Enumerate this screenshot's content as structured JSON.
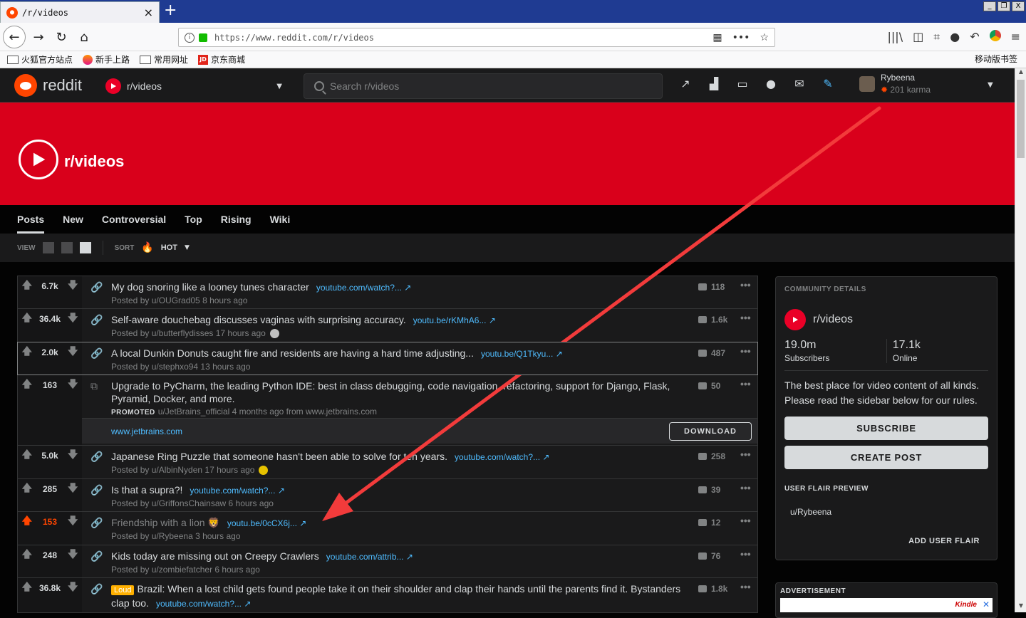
{
  "browser": {
    "tab_title": "/r/videos",
    "tab_close": "×",
    "new_tab": "+",
    "url": "https://www.reddit.com/r/videos",
    "nav": {
      "back": "←",
      "forward": "→",
      "reload": "↻",
      "home": "⌂"
    },
    "url_right": {
      "qr": "▦",
      "more": "•••",
      "star": "☆"
    },
    "tools": {
      "library": "|||\\",
      "sidebar": "◫",
      "crop": "⌗",
      "chat": "●",
      "undo": "↶",
      "menu": "≡"
    },
    "window_buttons": [
      "_",
      "❐",
      "X"
    ],
    "bookmarks": [
      {
        "label": "火狐官方站点",
        "icon": "folder-icon"
      },
      {
        "label": "新手上路",
        "icon": "firefox-icon"
      },
      {
        "label": "常用网址",
        "icon": "folder-icon"
      },
      {
        "label": "京东商城",
        "icon": "jd-icon",
        "icon_text": "JD"
      }
    ],
    "mobile_bookmarks": "移动版书签"
  },
  "header": {
    "logo_text": "reddit",
    "subreddit": "r/videos",
    "search_placeholder": "Search r/videos",
    "icons": [
      "trending-icon",
      "stats-icon",
      "cc-icon",
      "chat-icon",
      "mail-icon",
      "pencil-icon"
    ],
    "icon_glyphs": [
      "↗",
      "▟",
      "▭",
      "●",
      "✉",
      "✎"
    ],
    "username": "Rybeena",
    "karma": "201 karma",
    "caret": "▼"
  },
  "banner": {
    "title": "r/videos"
  },
  "tabs": [
    {
      "label": "Posts",
      "active": true
    },
    {
      "label": "New"
    },
    {
      "label": "Controversial"
    },
    {
      "label": "Top"
    },
    {
      "label": "Rising"
    },
    {
      "label": "Wiki"
    }
  ],
  "viewbar": {
    "view_label": "VIEW",
    "sort_label": "SORT",
    "sort_value": "HOT",
    "flame": "🔥",
    "caret": "▼"
  },
  "posts": [
    {
      "score": "6.7k",
      "title": "My dog snoring like a looney tunes character",
      "domain": "youtube.com/watch?...",
      "meta": "Posted by u/OUGrad05 8 hours ago",
      "comments": "118"
    },
    {
      "score": "36.4k",
      "title": "Self-aware douchebag discusses vaginas with surprising accuracy.",
      "domain": "youtu.be/rKMhA6...",
      "meta": "Posted by u/butterflydisses 17 hours ago",
      "comments": "1.6k",
      "badge": "silver-award-icon"
    },
    {
      "score": "2.0k",
      "title": "A local Dunkin Donuts caught fire and residents are having a hard time adjusting...",
      "domain": "youtu.be/Q1Tkyu...",
      "meta": "Posted by u/stephxo94 13 hours ago",
      "comments": "487",
      "highlight": true
    },
    {
      "score": "163",
      "title": "Upgrade to PyCharm, the leading Python IDE: best in class debugging, code navigation, refactoring, support for Django, Flask, Pyramid, Docker, and more.",
      "promoted_label": "PROMOTED",
      "meta": "u/JetBrains_official 4 months ago from www.jetbrains.com",
      "comments": "50",
      "promo_link": "www.jetbrains.com",
      "promo_button": "DOWNLOAD"
    },
    {
      "score": "5.0k",
      "title": "Japanese Ring Puzzle that someone hasn't been able to solve for ten years.",
      "domain": "youtube.com/watch?...",
      "meta": "Posted by u/AlbinNyden 17 hours ago",
      "comments": "258",
      "badge": "gold-award-icon"
    },
    {
      "score": "285",
      "title": "Is that a supra?!",
      "domain": "youtube.com/watch?...",
      "meta": "Posted by u/GriffonsChainsaw 6 hours ago",
      "comments": "39"
    },
    {
      "score": "153",
      "title": "Friendship with a lion 🦁",
      "domain": "youtu.be/0cCX6j...",
      "meta": "Posted by u/Rybeena 3 hours ago",
      "comments": "12",
      "upvoted": true,
      "visited": true
    },
    {
      "score": "248",
      "title": "Kids today are missing out on Creepy Crawlers",
      "domain": "youtube.com/attrib...",
      "meta": "Posted by u/zombiefatcher 6 hours ago",
      "comments": "76"
    },
    {
      "score": "36.8k",
      "flair": "Loud",
      "title": "Brazil: When a lost child gets found people take it on their shoulder and clap their hands until the parents find it. Bystanders clap too.",
      "domain": "youtube.com/watch?...",
      "meta": "",
      "comments": "1.8k"
    }
  ],
  "glyphs": {
    "up": "🡅",
    "down": "🡇",
    "link": "🔗",
    "promo_link": "⧉",
    "external": "↗",
    "more": "•••",
    "scroll_up": "▲",
    "scroll_down": "▼"
  },
  "sidebar": {
    "label": "COMMUNITY DETAILS",
    "name": "r/videos",
    "subscribers": "19.0m",
    "subscribers_label": "Subscribers",
    "online": "17.1k",
    "online_label": "Online",
    "description": "The best place for video content of all kinds. Please read the sidebar below for our rules.",
    "subscribe": "SUBSCRIBE",
    "create_post": "CREATE POST",
    "flair_label": "USER FLAIR PREVIEW",
    "flair_user": "u/Rybeena",
    "add_flair": "ADD USER FLAIR"
  },
  "ad": {
    "label": "ADVERTISEMENT",
    "brand": "Kindle",
    "close": "✕"
  },
  "colors": {
    "annotation_arrow": "#f23b3b",
    "brand": "#ff4500",
    "banner": "#d9001b"
  }
}
